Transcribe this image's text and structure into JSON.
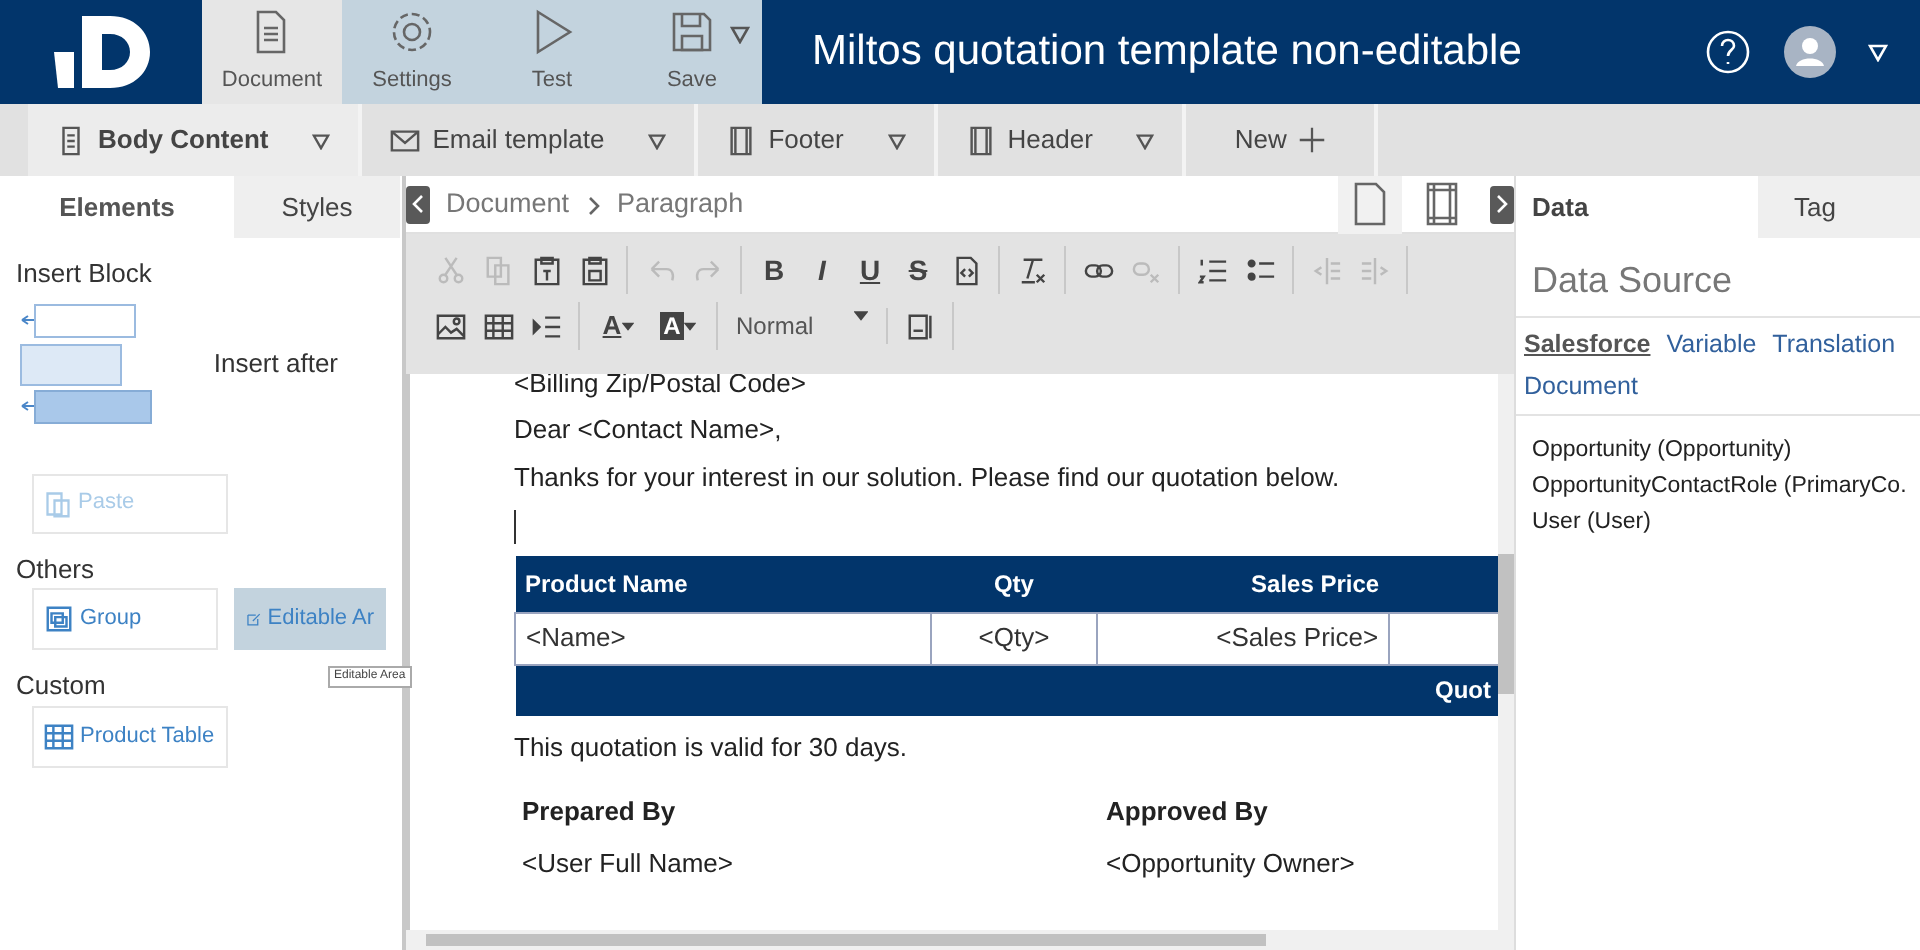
{
  "app_bar": {
    "tools": [
      {
        "label": "Document",
        "kind": "document",
        "selected": true
      },
      {
        "label": "Settings",
        "kind": "settings",
        "selected": false
      },
      {
        "label": "Test",
        "kind": "test",
        "selected": false
      },
      {
        "label": "Save",
        "kind": "save",
        "selected": false
      }
    ],
    "title": "Miltos quotation template non-editable"
  },
  "template_tabs": [
    {
      "label": "Body Content",
      "kind": "body",
      "selected": true
    },
    {
      "label": "Email template",
      "kind": "email",
      "selected": false
    },
    {
      "label": "Footer",
      "kind": "footer",
      "selected": false
    },
    {
      "label": "Header",
      "kind": "header",
      "selected": false
    },
    {
      "label": "New",
      "kind": "new",
      "selected": false
    }
  ],
  "left_panel": {
    "tabs": [
      {
        "label": "Elements",
        "selected": true
      },
      {
        "label": "Styles",
        "selected": false
      }
    ],
    "insert_block": {
      "heading": "Insert Block",
      "option": "Insert after"
    },
    "paste": {
      "label": "Paste",
      "disabled": true
    },
    "sections": [
      {
        "heading": "Others",
        "items": [
          {
            "label": "Group",
            "kind": "group",
            "selected": false
          },
          {
            "label": "Editable Ar",
            "kind": "editable",
            "selected": true
          }
        ]
      },
      {
        "heading": "Custom",
        "items": [
          {
            "label": "Product Table",
            "kind": "table",
            "selected": false
          }
        ]
      }
    ],
    "tooltip": "Editable Area"
  },
  "editor": {
    "breadcrumb": [
      "Document",
      "Paragraph"
    ],
    "page_modes": [
      {
        "kind": "page",
        "selected": true
      },
      {
        "kind": "margins",
        "selected": false
      }
    ],
    "toolbar": [
      [
        [
          {
            "kind": "cut",
            "disabled": true
          },
          {
            "kind": "copy",
            "disabled": true
          },
          {
            "kind": "paste-text",
            "disabled": false
          },
          {
            "kind": "paste-word",
            "disabled": false
          }
        ],
        [
          {
            "kind": "undo",
            "disabled": true
          },
          {
            "kind": "redo",
            "disabled": true
          }
        ],
        [
          {
            "kind": "bold",
            "label": "B",
            "disabled": false
          },
          {
            "kind": "italic",
            "label": "I",
            "disabled": false
          },
          {
            "kind": "underline",
            "label": "U",
            "disabled": false
          },
          {
            "kind": "strike",
            "label": "S",
            "disabled": false
          },
          {
            "kind": "source",
            "disabled": false
          }
        ],
        [
          {
            "kind": "clear-format",
            "disabled": false
          }
        ],
        [
          {
            "kind": "link",
            "disabled": false
          },
          {
            "kind": "unlink",
            "disabled": true
          }
        ],
        [
          {
            "kind": "numbered-list",
            "disabled": false
          },
          {
            "kind": "bullet-list",
            "disabled": false
          }
        ],
        [
          {
            "kind": "outdent",
            "disabled": true
          },
          {
            "kind": "indent",
            "disabled": true
          }
        ]
      ],
      [
        [
          {
            "kind": "image",
            "disabled": false
          },
          {
            "kind": "table",
            "disabled": false
          },
          {
            "kind": "list-indent",
            "disabled": false
          }
        ],
        [
          {
            "kind": "text-color",
            "label": "A",
            "disabled": false
          },
          {
            "kind": "back-color",
            "label": "A",
            "disabled": false
          }
        ],
        [
          {
            "kind": "select",
            "label": "Normal",
            "disabled": false
          }
        ],
        [
          {
            "kind": "page-break",
            "disabled": false
          }
        ]
      ]
    ],
    "document": {
      "lines": [
        "<Billing Zip/Postal Code>",
        "Dear <Contact Name>,",
        "Thanks for your interest in our solution. Please find our quotation below."
      ],
      "table": {
        "columns": [
          "Product Name",
          "Qty",
          "Sales Price"
        ],
        "row": [
          "<Name>",
          "<Qty>",
          "<Sales Price>"
        ],
        "footer": "Quot"
      },
      "note": "This quotation is valid for 30 days.",
      "signatures": [
        {
          "heading": "Prepared By",
          "value": "<User Full Name>"
        },
        {
          "heading": "Approved By",
          "value": "<Opportunity Owner>"
        }
      ]
    }
  },
  "right_panel": {
    "tabs": [
      {
        "label": "Data",
        "selected": true
      },
      {
        "label": "Tag",
        "selected": false
      }
    ],
    "heading": "Data Source",
    "sources": [
      {
        "label": "Salesforce",
        "selected": true
      },
      {
        "label": "Variable",
        "selected": false
      },
      {
        "label": "Translation",
        "selected": false
      },
      {
        "label": "Document",
        "selected": false
      }
    ],
    "objects": [
      "Opportunity (Opportunity)",
      "OpportunityContactRole (PrimaryCo.",
      "User (User)"
    ]
  }
}
